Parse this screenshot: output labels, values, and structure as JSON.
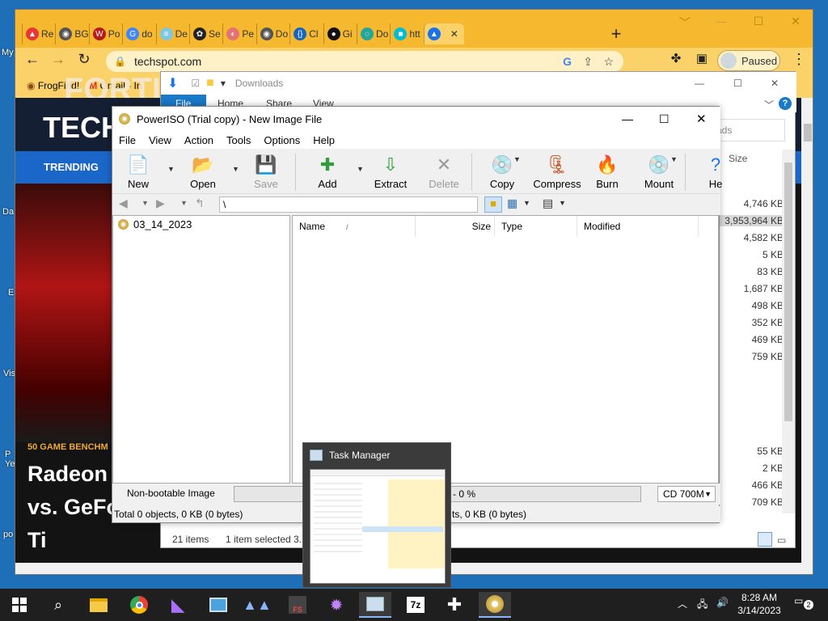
{
  "desktop": {
    "labels": [
      "My",
      "Da",
      "E",
      "Vis",
      "P\nYe",
      "po"
    ]
  },
  "chrome": {
    "tabs": [
      {
        "label": "Re",
        "color": "#e53935",
        "glyph": "▲"
      },
      {
        "label": "BG",
        "color": "#555555",
        "glyph": "◉"
      },
      {
        "label": "Po",
        "color": "#b71c1c",
        "glyph": "W"
      },
      {
        "label": "do",
        "color": "#4285f4",
        "glyph": "G"
      },
      {
        "label": "De",
        "color": "#7ec8e3",
        "glyph": "≡"
      },
      {
        "label": "Se",
        "color": "#222222",
        "glyph": "✿"
      },
      {
        "label": "Pe",
        "color": "#e57373",
        "glyph": "◐"
      },
      {
        "label": "Do",
        "color": "#555555",
        "glyph": "◉"
      },
      {
        "label": "Cl",
        "color": "#1565c0",
        "glyph": "{}"
      },
      {
        "label": "Gi",
        "color": "#111111",
        "glyph": "●"
      },
      {
        "label": "Do",
        "color": "#26a69a",
        "glyph": "◌"
      },
      {
        "label": "htt",
        "color": "#00bcd4",
        "glyph": "■"
      },
      {
        "label": "",
        "color": "#1a73e8",
        "glyph": "▲"
      }
    ],
    "url": "techspot.com",
    "profile": "Paused",
    "bookmarks": [
      "FrogFind!",
      "Gmail - In"
    ]
  },
  "techspot": {
    "title": "TECH",
    "trending": "TRENDING",
    "tag": "50 GAME BENCHM",
    "headline": [
      "Radeon",
      "vs. GeFo",
      "Ti"
    ],
    "bg_text": "FORTI"
  },
  "explorer": {
    "title": "Downloads",
    "ribbon": [
      "File",
      "Home",
      "Share",
      "View"
    ],
    "search_fragment": "ads",
    "size_header": "Size",
    "sizes_top": [
      "4,746 KB",
      "3,953,964 KB",
      "4,582 KB",
      "5 KB",
      "83 KB",
      "1,687 KB",
      "498 KB",
      "352 KB",
      "469 KB",
      "759 KB"
    ],
    "sizes_bottom": [
      "55 KB",
      "2 KB",
      "466 KB",
      "709 KB"
    ],
    "status_items": "21 items",
    "status_selected": "1 item selected",
    "status_size_frag": "3."
  },
  "poweriso": {
    "title": "PowerISO (Trial copy) - New Image File",
    "menu": [
      "File",
      "View",
      "Action",
      "Tools",
      "Options",
      "Help"
    ],
    "toolbar": [
      {
        "label": "New",
        "icon": "new-icon",
        "glyph": "📄",
        "dropdown": true
      },
      {
        "label": "Open",
        "icon": "open-icon",
        "glyph": "📂",
        "dropdown": true
      },
      {
        "label": "Save",
        "icon": "save-icon",
        "glyph": "💾",
        "disabled": true
      },
      {
        "label": "Add",
        "icon": "add-icon",
        "glyph": "✚",
        "dropdown": true
      },
      {
        "label": "Extract",
        "icon": "extract-icon",
        "glyph": "⇩"
      },
      {
        "label": "Delete",
        "icon": "delete-icon",
        "glyph": "✕",
        "disabled": true
      },
      {
        "label": "Copy",
        "icon": "copy-icon",
        "glyph": "💿",
        "dropdown": true
      },
      {
        "label": "Compress",
        "icon": "compress-icon",
        "glyph": "🗜"
      },
      {
        "label": "Burn",
        "icon": "burn-icon",
        "glyph": "🔥"
      },
      {
        "label": "Mount",
        "icon": "mount-icon",
        "glyph": "💿",
        "dropdown": true
      },
      {
        "label": "He",
        "icon": "help-icon",
        "glyph": "?"
      }
    ],
    "path": "\\",
    "tree_root": "03_14_2023",
    "columns": [
      "Name",
      "Size",
      "Type",
      "Modified"
    ],
    "sort_indicator": "/",
    "image_type": "Non-bootable Image",
    "progress_text": "- 0 %",
    "media": "CD 700M",
    "status_left": "Total 0 objects, 0 KB (0 bytes)",
    "status_right": "ts, 0 KB (0 bytes)"
  },
  "taskmanager_preview": {
    "title": "Task Manager"
  },
  "taskbar": {
    "time": "8:28 AM",
    "date": "3/14/2023",
    "notifications": "2"
  }
}
